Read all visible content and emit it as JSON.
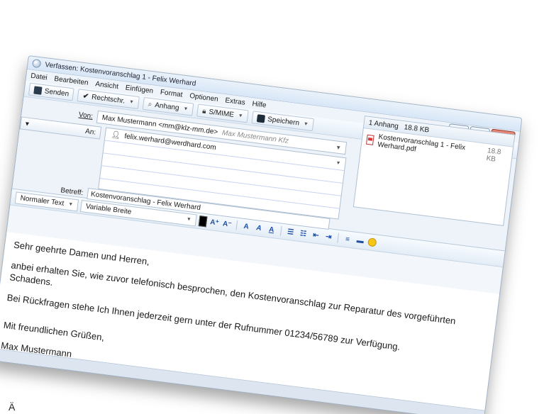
{
  "window": {
    "title": "Verfassen: Kostenvoranschlag 1 - Felix Werhard",
    "controls": [
      "–",
      "□",
      "✕"
    ]
  },
  "menu": {
    "items": [
      "Datei",
      "Bearbeiten",
      "Ansicht",
      "Einfügen",
      "Format",
      "Optionen",
      "Extras",
      "Hilfe"
    ]
  },
  "toolbar": {
    "send": "Senden",
    "spell": "Rechtschr.",
    "attach": "Anhang",
    "smime": "S/MIME",
    "save": "Speichern"
  },
  "compose": {
    "from_label": "Von:",
    "from_value": "Max Mustermann <mm@klz-mm.de>",
    "from_identity": "Max Mustermann Kfz",
    "to_combo": "An:",
    "to_recipient": "felix.werhard@werdhard.com",
    "subject_label": "Betreff:",
    "subject_value": "Kostenvoranschlag - Felix Werhard"
  },
  "attachments": {
    "header_count": "1 Anhang",
    "header_size": "18.8 KB",
    "items": [
      {
        "name": "Kostenvoranschlag 1 - Felix Werhard.pdf",
        "size": "18.8 KB"
      }
    ]
  },
  "format": {
    "paragraph_style": "Normaler Text",
    "font": "Variable Breite"
  },
  "body": {
    "greeting": "Sehr geehrte Damen und Herren,",
    "para1": "anbei erhalten Sie, wie zuvor telefonisch besprochen, den Kostenvoranschlag zur Reparatur des vorgeführten Schadens.",
    "para2": "Bei Rückfragen stehe Ich Ihnen jederzeit gern unter der Rufnummer 01234/56789 zur Verfügung.",
    "closing": "Mit freundlichen Grüßen,",
    "signature": "Max Mustermann"
  },
  "footer_text": "Ä"
}
